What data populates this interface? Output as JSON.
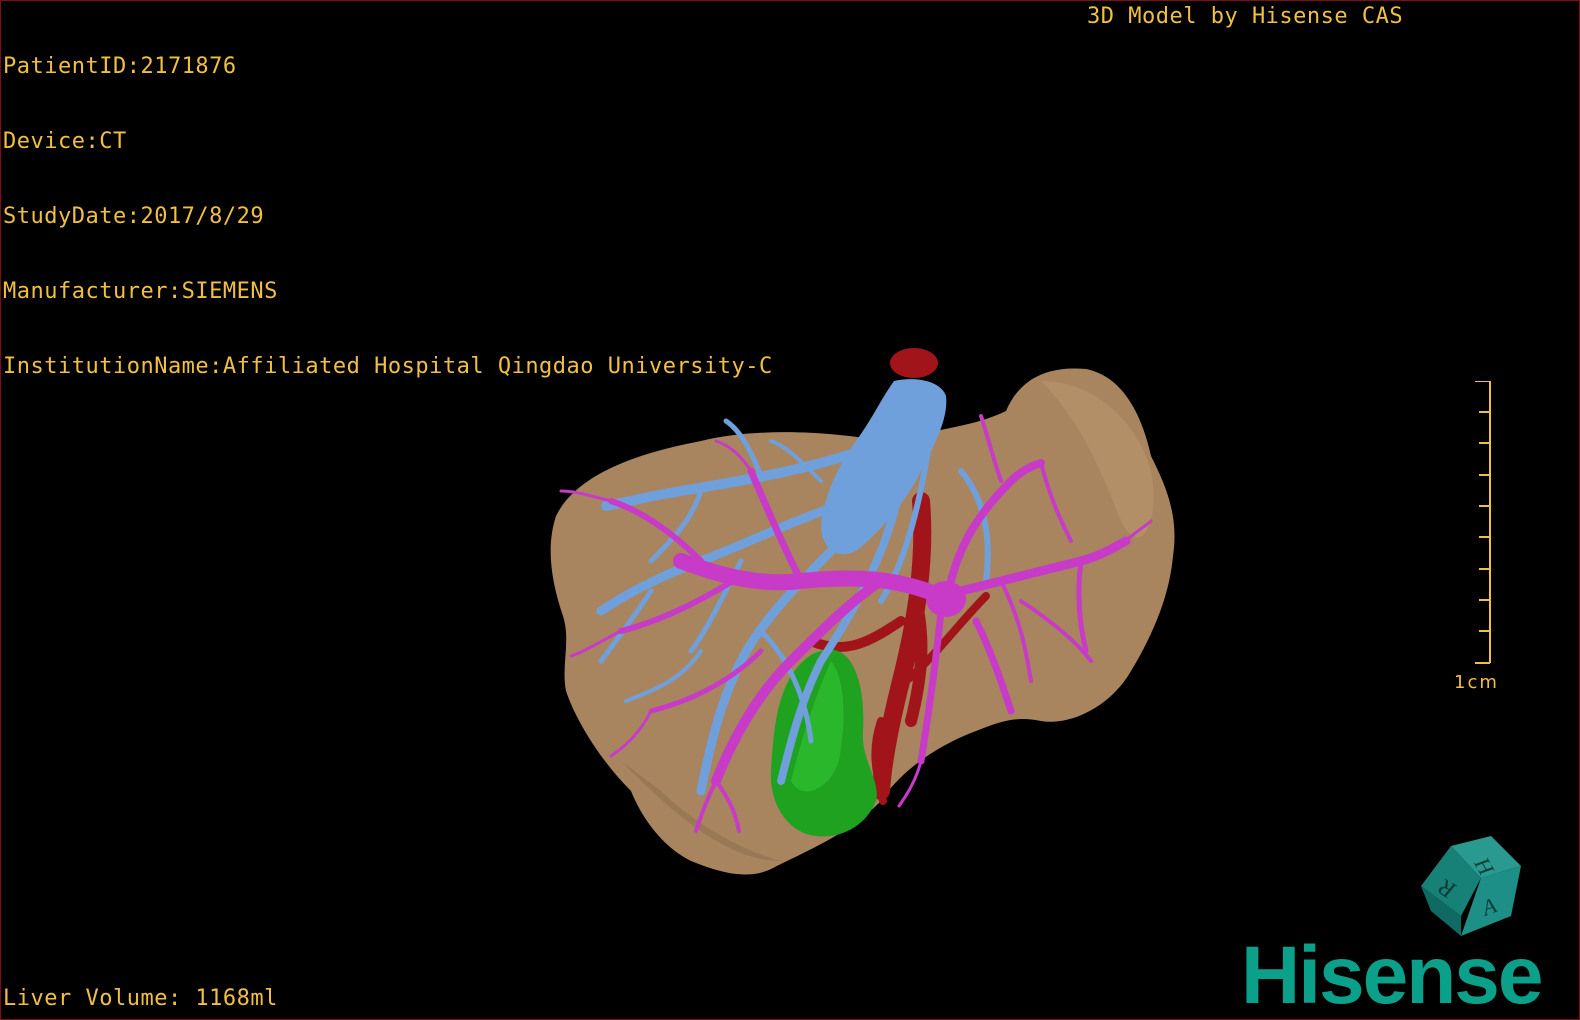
{
  "overlay": {
    "patient_id": "PatientID:2171876",
    "device": "Device:CT",
    "study_date": "StudyDate:2017/8/29",
    "manufacturer": "Manufacturer:SIEMENS",
    "institution": "InstitutionName:Affiliated Hospital Qingdao University-C",
    "model_credit": "3D Model by Hisense CAS",
    "liver_volume": "Liver Volume: 1168ml"
  },
  "scale_bar": {
    "label": "1cm"
  },
  "orientation_cube": {
    "letters": [
      "H",
      "R",
      "A"
    ],
    "color": "#1e8f86"
  },
  "brand": {
    "text": "Hisense",
    "color": "#0aa08a"
  },
  "model": {
    "structures": [
      {
        "name": "liver",
        "color": "#a8855f"
      },
      {
        "name": "hepatic-veins",
        "color": "#6fa0dc"
      },
      {
        "name": "portal-vein",
        "color": "#c83ac8"
      },
      {
        "name": "arteries",
        "color": "#a0141a"
      },
      {
        "name": "gallbladder",
        "color": "#1fa21f"
      }
    ]
  },
  "colors": {
    "overlay_text": "#f2c040",
    "background": "#000000",
    "frame": "#7a0f16"
  }
}
